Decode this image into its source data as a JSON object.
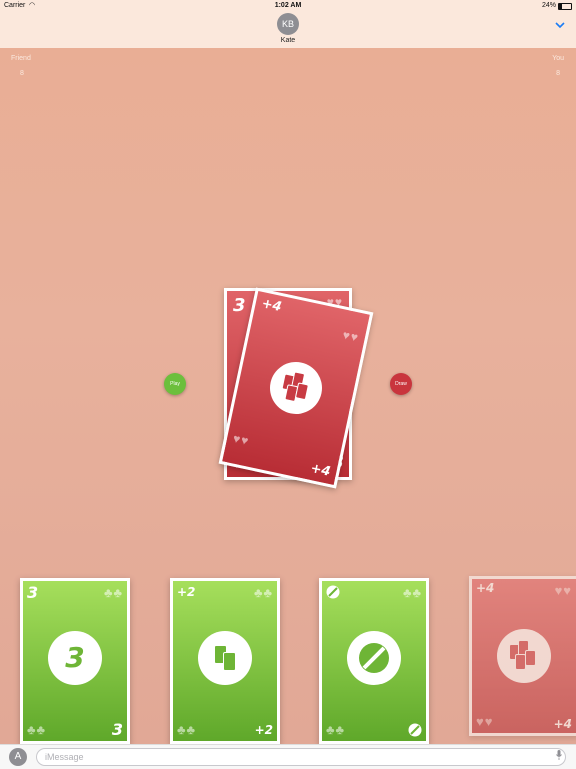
{
  "status_bar": {
    "carrier": "Carrier",
    "time": "1:02 AM",
    "battery": "24%"
  },
  "header": {
    "avatar_initials": "KB",
    "contact_name": "Kate"
  },
  "scores": {
    "friend": {
      "label": "Friend",
      "value": "8"
    },
    "you": {
      "label": "You",
      "value": "8"
    }
  },
  "controls": {
    "play_label": "Play",
    "draw_label": "Draw"
  },
  "pile": {
    "under_card": {
      "value": "3",
      "suit": "hearts",
      "color": "red"
    },
    "top_card": {
      "value": "+4",
      "suit": "hearts",
      "color": "red"
    }
  },
  "hand": [
    {
      "value": "3",
      "suit": "clubs",
      "color": "green",
      "center": "3"
    },
    {
      "value": "+2",
      "suit": "clubs",
      "color": "green",
      "center": "draw-two-icon"
    },
    {
      "value": "skip",
      "suit": "clubs",
      "color": "green",
      "center": "skip-icon"
    },
    {
      "value": "+4",
      "suit": "hearts",
      "color": "red",
      "center": "draw-four-icon",
      "dimmed": true
    }
  ],
  "input": {
    "placeholder": "iMessage"
  },
  "colors": {
    "red": "#c83b43",
    "green": "#6eb536",
    "background": "#e9b6a1"
  }
}
